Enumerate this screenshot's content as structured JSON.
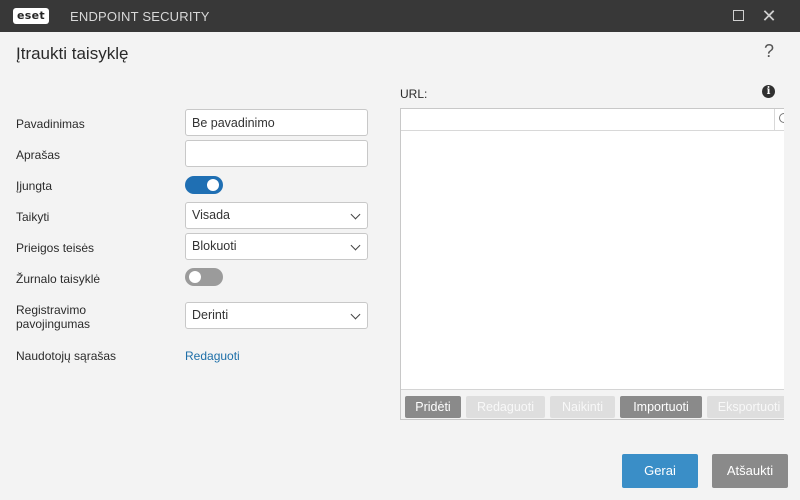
{
  "titlebar": {
    "logo_text": "eset",
    "product_name": "ENDPOINT SECURITY",
    "maximize_glyph": "",
    "close_glyph": "✕"
  },
  "header": {
    "title": "Įtraukti taisyklę",
    "help_glyph": "?"
  },
  "form": {
    "name_label": "Pavadinimas",
    "name_value": "Be pavadinimo",
    "description_label": "Aprašas",
    "description_value": "",
    "enabled_label": "Įjungta",
    "enabled": true,
    "apply_label": "Taikyti",
    "apply_value": "Visada",
    "access_label": "Prieigos teisės",
    "access_value": "Blokuoti",
    "log_rule_label": "Žurnalo taisyklė",
    "log_rule": false,
    "severity_label_line1": "Registravimo",
    "severity_label_line2": "pavojingumas",
    "severity_value": "Derinti",
    "users_label": "Naudotojų sąrašas",
    "users_link": "Redaguoti"
  },
  "url_panel": {
    "label": "URL:",
    "info_glyph": "i",
    "search_value": "",
    "toolbar": {
      "add": "Pridėti",
      "edit": "Redaguoti",
      "delete": "Naikinti",
      "import": "Importuoti",
      "export": "Eksportuoti"
    }
  },
  "footer": {
    "ok": "Gerai",
    "cancel": "Atšaukti"
  },
  "colors": {
    "accent": "#1f6fb3",
    "ok_button": "#3a8ec7",
    "titlebar": "#383838",
    "link": "#1e6fa8"
  },
  "icons": [
    "eset-logo",
    "maximize-icon",
    "close-icon",
    "help-icon",
    "info-icon",
    "search-icon",
    "chevron-down-icon"
  ]
}
